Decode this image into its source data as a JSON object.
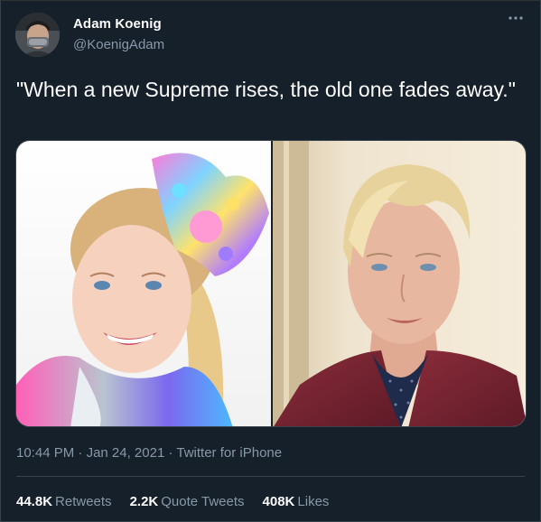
{
  "author": {
    "name": "Adam Koenig",
    "handle": "@KoenigAdam"
  },
  "tweet": {
    "text": "\"When a new Supreme rises, the old one fades away.\""
  },
  "meta": {
    "time": "10:44 PM",
    "dot1": " · ",
    "date": "Jan 24, 2021",
    "dot2": " · ",
    "source": "Twitter for iPhone"
  },
  "stats": [
    {
      "count": "44.8K",
      "label": "Retweets"
    },
    {
      "count": "2.2K",
      "label": "Quote Tweets"
    },
    {
      "count": "408K",
      "label": "Likes"
    }
  ],
  "icons": {
    "more": "more-horizontal-icon"
  },
  "colors": {
    "background": "#15202b",
    "text": "#ffffff",
    "secondary": "#8899a6",
    "border": "#38444d"
  }
}
